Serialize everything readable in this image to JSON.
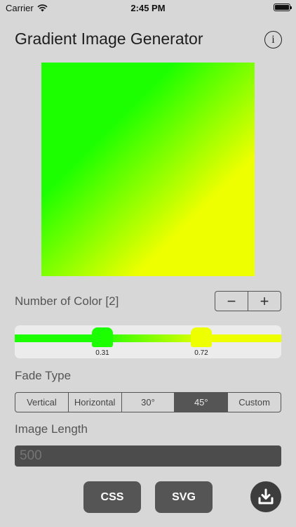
{
  "status_bar": {
    "carrier": "Carrier",
    "time": "2:45 PM"
  },
  "app": {
    "title": "Gradient Image Generator"
  },
  "preview": {
    "angle_deg": 45,
    "stops": [
      {
        "color": "#1bff00",
        "position": 0.31
      },
      {
        "color": "#eeff00",
        "position": 0.72
      }
    ]
  },
  "colors": {
    "label": "Number of Color [2]",
    "minus_label": "−",
    "plus_label": "+",
    "stops": [
      {
        "color": "#1bff00",
        "value": "0.31"
      },
      {
        "color": "#eeff00",
        "value": "0.72"
      }
    ]
  },
  "fade": {
    "label": "Fade Type",
    "options": [
      "Vertical",
      "Horizontal",
      "30°",
      "45°",
      "Custom"
    ],
    "selected": "45°"
  },
  "length": {
    "label": "Image Length",
    "placeholder": "500"
  },
  "actions": {
    "css_label": "CSS",
    "svg_label": "SVG"
  },
  "icons": {
    "info": "info-icon",
    "download": "download-icon",
    "wifi": "wifi-icon",
    "battery": "battery-icon"
  }
}
